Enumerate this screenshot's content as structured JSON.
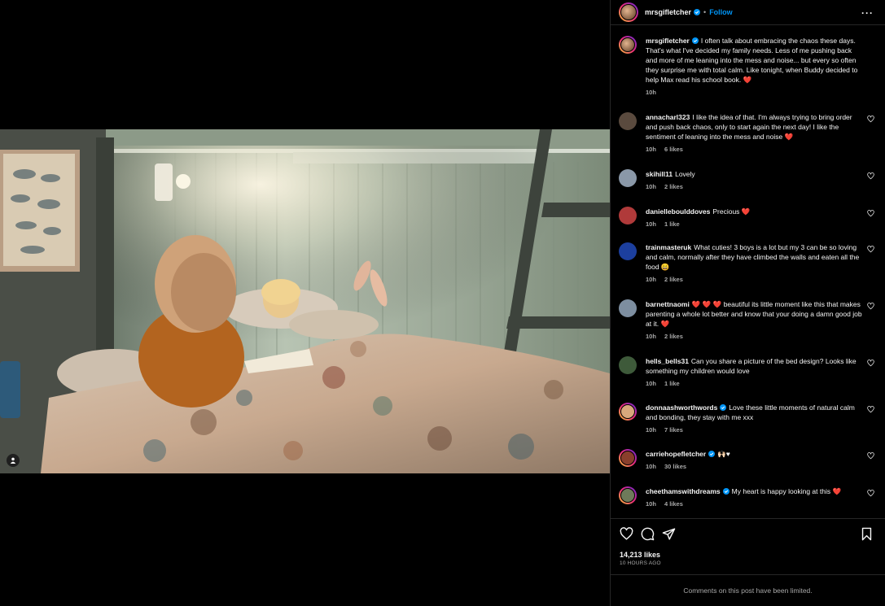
{
  "post": {
    "author": "mrsgifletcher",
    "follow_label": "Follow",
    "dot": "•",
    "more_icon": "more-horizontal-icon",
    "caption": "I often talk about embracing the chaos these days. That's what I've decided my family needs. Less of me pushing back and more of me leaning into the mess and noise... but every so often they surprise me with total calm. Like tonight, when Buddy decided to help Max read his school book.",
    "caption_emoji": "❤️",
    "caption_time": "10h",
    "likes": "14,213 likes",
    "posted_ago": "10 HOURS AGO",
    "limited_notice": "Comments on this post have been limited."
  },
  "comments": [
    {
      "user": "annacharl323",
      "text": "I like the idea of that. I'm always trying to bring order and push back chaos, only to start again the next day! I like the sentiment of leaning into the mess and noise",
      "emoji": "❤️",
      "time": "10h",
      "likes": "6 likes"
    },
    {
      "user": "skihill11",
      "text": "Lovely",
      "emoji": "",
      "time": "10h",
      "likes": "2 likes"
    },
    {
      "user": "danielleboulddoves",
      "text": "Precious",
      "emoji": "❤️",
      "time": "10h",
      "likes": "1 like"
    },
    {
      "user": "trainmasteruk",
      "text": "What cuties! 3 boys is a lot but my 3 can be so loving and calm, normally after they have climbed the walls and eaten all the food",
      "emoji": "😄",
      "time": "10h",
      "likes": "2 likes"
    },
    {
      "user": "barnettnaomi",
      "text_pre": "❤️ ❤️ ❤️",
      "text": "beautiful its little moment like this that makes parenting a whole lot better and know that your doing a damn good job at it.",
      "emoji": "❤️",
      "time": "10h",
      "likes": "2 likes"
    },
    {
      "user": "hells_bells31",
      "text": "Can you share a picture of the bed design? Looks like something my children would love",
      "emoji": "",
      "time": "10h",
      "likes": "1 like"
    },
    {
      "user": "donnaashworthwords",
      "text": "Love these little moments of natural calm and bonding, they stay with me xxx",
      "emoji": "",
      "time": "10h",
      "likes": "7 likes"
    },
    {
      "user": "carriehopefletcher",
      "text": "🙌🏻♥",
      "emoji": "",
      "time": "10h",
      "likes": "30 likes"
    },
    {
      "user": "cheethamswithdreams",
      "text": "My heart is happy looking at this",
      "emoji": "❤️",
      "time": "10h",
      "likes": "4 likes"
    }
  ],
  "icons": {
    "like": "heart-icon",
    "comment": "comment-icon",
    "share": "share-icon",
    "save": "bookmark-icon",
    "tag": "user-tag-icon",
    "verified": "verified-badge-icon"
  },
  "colors": {
    "accent": "#0095f6",
    "heart": "#ff3040",
    "secondary_text": "#a8a8a8",
    "border": "#262626"
  }
}
